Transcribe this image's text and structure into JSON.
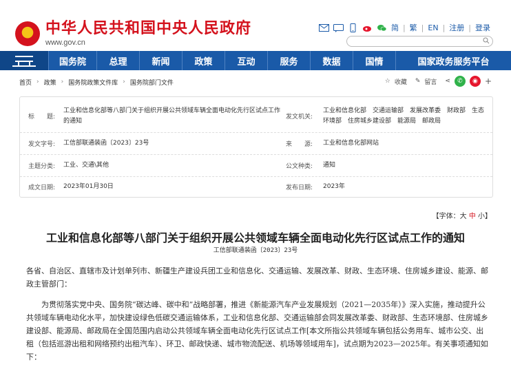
{
  "header": {
    "site_title": "中华人民共和国中央人民政府",
    "site_url": "www.gov.cn",
    "links": [
      "简",
      "繁",
      "EN",
      "注册",
      "登录"
    ],
    "icons": [
      "mail-icon",
      "sms-icon",
      "mobile-icon",
      "weibo-icon",
      "wechat-icon"
    ],
    "search_placeholder": ""
  },
  "nav": {
    "items": [
      "国务院",
      "总理",
      "新闻",
      "政策",
      "互动",
      "服务",
      "数据",
      "国情",
      "国家政务服务平台"
    ]
  },
  "breadcrumb": [
    "首页",
    "政策",
    "国务院政策文件库",
    "国务院部门文件"
  ],
  "actions": {
    "favorite": "收藏",
    "comment": "留言",
    "plus": "+"
  },
  "info": {
    "title_label": "标　　题:",
    "title_value": "工业和信息化部等八部门关于组织开展公共领域车辆全面电动化先行区试点工作的通知",
    "issuer_label": "发文机关:",
    "issuer_value": "工业和信息化部　交通运输部　发展改革委　财政部　生态环境部　住房城乡建设部　能源局　邮政局",
    "docno_label": "发文字号:",
    "docno_value": "工信部联通装函〔2023〕23号",
    "source_label": "来　　源:",
    "source_value": "工业和信息化部网站",
    "topic_label": "主题分类:",
    "topic_value": "工业、交通\\其他",
    "type_label": "公文种类:",
    "type_value": "通知",
    "date_label": "成文日期:",
    "date_value": "2023年01月30日",
    "pubdate_label": "发布日期:",
    "pubdate_value": "2023年"
  },
  "fontsize": {
    "prefix": "【字体：",
    "large": "大",
    "medium": "中",
    "small": "小",
    "suffix": "】"
  },
  "article": {
    "title": "工业和信息化部等八部门关于组织开展公共领域车辆全面电动化先行区试点工作的通知",
    "doc_number": "工信部联通装函〔2023〕23号",
    "p1": "各省、自治区、直辖市及计划单列市、新疆生产建设兵团工业和信息化、交通运输、发展改革、财政、生态环境、住房城乡建设、能源、邮政主管部门：",
    "p2": "为贯彻落实党中央、国务院“碳达峰、碳中和”战略部署，推进《新能源汽车产业发展规划（2021—2035年）》深入实施，推动提升公共领域车辆电动化水平，加快建设绿色低碳交通运输体系，工业和信息化部、交通运输部会同发展改革委、财政部、生态环境部、住房城乡建设部、能源局、邮政局在全国范围内启动公共领域车辆全面电动化先行区试点工作[本文所指公共领域车辆包括公务用车、城市公交、出租（包括巡游出租和网络预约出租汽车）、环卫、邮政快递、城市物流配送、机场等领域用车]，试点期为2023—2025年。有关事项通知如下："
  }
}
